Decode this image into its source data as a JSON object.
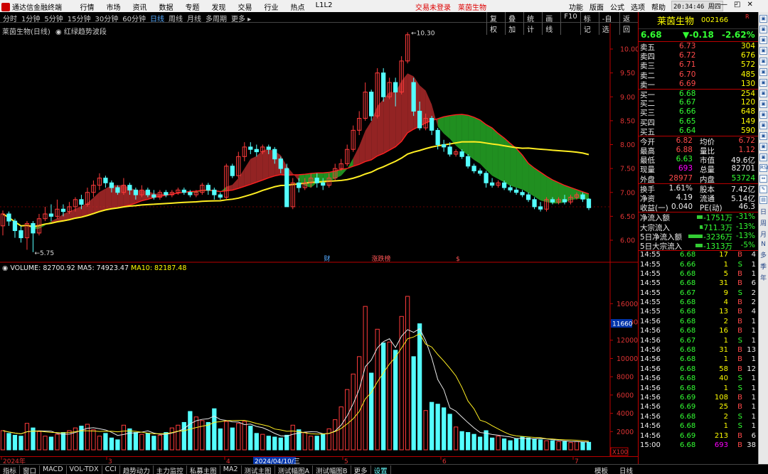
{
  "app": {
    "title": "通达信金融终端",
    "menu": [
      "行情",
      "市场",
      "资讯",
      "数据",
      "专题",
      "发现",
      "交易",
      "行业",
      "热点",
      "L1L2"
    ],
    "login_status": "交易未登录",
    "stock_tab": "莱茵生物",
    "right_menu": [
      "功能",
      "版面",
      "公式",
      "选项",
      "帮助"
    ],
    "clock": "20:34:46 周四",
    "window_buttons": [
      "—",
      "◰",
      "✕"
    ]
  },
  "toolbar": {
    "periods": [
      "分时",
      "1分钟",
      "5分钟",
      "15分钟",
      "30分钟",
      "60分钟",
      "日线",
      "周线",
      "月线",
      "多周期",
      "更多 ▸"
    ],
    "active_period": "日线",
    "tools": [
      "复权",
      "叠加",
      "统计",
      "画线",
      "F10",
      "标记",
      "-自选",
      "返回"
    ]
  },
  "kline": {
    "title": "莱茵生物(日线)",
    "indicator": "红绿趋势波段",
    "high_label": "10.30",
    "low_label": "5.75",
    "y_ticks": [
      "10.00",
      "9.50",
      "9.00",
      "8.50",
      "8.00",
      "7.50",
      "7.00",
      "6.50",
      "6.00"
    ],
    "event_markers": [
      "财",
      "涨跌榜",
      "$"
    ]
  },
  "volume": {
    "legend_vol": "VOLUME: 82700.92",
    "legend_ma5": "MA5: 74923.47",
    "legend_ma10": "MA10: 82187.48",
    "y_ticks": [
      "16000",
      "14000",
      "12000",
      "10000",
      "8000",
      "6000",
      "4000",
      "2000"
    ],
    "current_tag": "11660",
    "unit_tag": "X100"
  },
  "date_axis": {
    "labels": [
      "2024年",
      "3",
      "4",
      "5",
      "6",
      "7"
    ],
    "cursor_date": "2024/04/10/三"
  },
  "bottom_tabs": [
    "指标",
    "窗口",
    "MACD",
    "VOL-TDX",
    "CCI",
    "趋势动力",
    "主力监控",
    "私募主图",
    "MA2",
    "测试主图",
    "测试幅图A",
    "测试幅图B",
    "更多",
    "设置"
  ],
  "bottom_right": [
    "模板",
    "日线"
  ],
  "quote": {
    "name": "莱茵生物",
    "code": "002166",
    "flag": "R",
    "price": "6.68",
    "change": "▼-0.18",
    "change_pct": "-2.62%",
    "order_book": [
      {
        "label": "卖五",
        "price": "6.73",
        "vol": "304",
        "pc": "red"
      },
      {
        "label": "卖四",
        "price": "6.72",
        "vol": "676",
        "pc": "red"
      },
      {
        "label": "卖三",
        "price": "6.71",
        "vol": "572",
        "pc": "red"
      },
      {
        "label": "卖二",
        "price": "6.70",
        "vol": "485",
        "pc": "red"
      },
      {
        "label": "卖一",
        "price": "6.69",
        "vol": "130",
        "pc": "red"
      },
      {
        "label": "买一",
        "price": "6.68",
        "vol": "254",
        "pc": "green"
      },
      {
        "label": "买二",
        "price": "6.67",
        "vol": "120",
        "pc": "green"
      },
      {
        "label": "买三",
        "price": "6.66",
        "vol": "648",
        "pc": "green"
      },
      {
        "label": "买四",
        "price": "6.65",
        "vol": "149",
        "pc": "green"
      },
      {
        "label": "买五",
        "price": "6.64",
        "vol": "590",
        "pc": "green"
      }
    ],
    "stats": [
      {
        "l1": "今开",
        "v1": "6.82",
        "c1": "red",
        "l2": "均价",
        "v2": "6.72",
        "c2": "red"
      },
      {
        "l1": "最高",
        "v1": "6.88",
        "c1": "red",
        "l2": "量比",
        "v2": "1.12",
        "c2": "red"
      },
      {
        "l1": "最低",
        "v1": "6.63",
        "c1": "green",
        "l2": "市值",
        "v2": "49.6亿",
        "c2": "white"
      },
      {
        "l1": "现量",
        "v1": "693",
        "c1": "magenta",
        "l2": "总量",
        "v2": "82701",
        "c2": "white"
      },
      {
        "l1": "外盘",
        "v1": "28977",
        "c1": "red",
        "l2": "内盘",
        "v2": "53724",
        "c2": "green"
      }
    ],
    "stats2": [
      {
        "l1": "换手",
        "v1": "1.61%",
        "c1": "white",
        "l2": "股本",
        "v2": "7.42亿",
        "c2": "white"
      },
      {
        "l1": "净资",
        "v1": "4.19",
        "c1": "white",
        "l2": "流通",
        "v2": "5.14亿",
        "c2": "white"
      },
      {
        "l1": "收益(一)",
        "v1": "0.040",
        "c1": "white",
        "l2": "PE(动)",
        "v2": "46.3",
        "c2": "white"
      }
    ],
    "flows": [
      {
        "label": "净流入额",
        "amount": "-1751万",
        "pct": "-31%"
      },
      {
        "label": "大宗流入",
        "amount": "-711.3万",
        "pct": "-13%"
      },
      {
        "label": "5日净流入额",
        "amount": "-3236万",
        "pct": "-13%"
      },
      {
        "label": "5日大宗流入",
        "amount": "-1313万",
        "pct": "-5%"
      }
    ],
    "ticks": [
      {
        "t": "14:55",
        "p": "6.68",
        "v": "17",
        "bs": "B",
        "n": "4"
      },
      {
        "t": "14:55",
        "p": "6.66",
        "v": "1",
        "bs": "S",
        "n": "1"
      },
      {
        "t": "14:55",
        "p": "6.68",
        "v": "5",
        "bs": "B",
        "n": "1"
      },
      {
        "t": "14:55",
        "p": "6.68",
        "v": "31",
        "bs": "B",
        "n": "6"
      },
      {
        "t": "14:55",
        "p": "6.67",
        "v": "9",
        "bs": "S",
        "n": "2"
      },
      {
        "t": "14:55",
        "p": "6.68",
        "v": "4",
        "bs": "B",
        "n": "2"
      },
      {
        "t": "14:55",
        "p": "6.68",
        "v": "13",
        "bs": "B",
        "n": "4"
      },
      {
        "t": "14:56",
        "p": "6.68",
        "v": "2",
        "bs": "B",
        "n": "1"
      },
      {
        "t": "14:56",
        "p": "6.68",
        "v": "16",
        "bs": "B",
        "n": "1"
      },
      {
        "t": "14:56",
        "p": "6.67",
        "v": "1",
        "bs": "S",
        "n": "1"
      },
      {
        "t": "14:56",
        "p": "6.68",
        "v": "31",
        "bs": "B",
        "n": "13"
      },
      {
        "t": "14:56",
        "p": "6.68",
        "v": "1",
        "bs": "B",
        "n": "1"
      },
      {
        "t": "14:56",
        "p": "6.68",
        "v": "58",
        "bs": "B",
        "n": "12"
      },
      {
        "t": "14:56",
        "p": "6.68",
        "v": "40",
        "bs": "S",
        "n": "1"
      },
      {
        "t": "14:56",
        "p": "6.68",
        "v": "1",
        "bs": "S",
        "n": "1"
      },
      {
        "t": "14:56",
        "p": "6.69",
        "v": "108",
        "bs": "B",
        "n": "1"
      },
      {
        "t": "14:56",
        "p": "6.69",
        "v": "25",
        "bs": "B",
        "n": "1"
      },
      {
        "t": "14:56",
        "p": "6.68",
        "v": "2",
        "bs": "S",
        "n": "1"
      },
      {
        "t": "14:56",
        "p": "6.68",
        "v": "1",
        "bs": "S",
        "n": "1"
      },
      {
        "t": "14:56",
        "p": "6.69",
        "v": "213",
        "bs": "B",
        "n": "6"
      },
      {
        "t": "15:00",
        "p": "6.68",
        "v": "693",
        "bs": "B",
        "n": "38"
      }
    ]
  },
  "sidebar": {
    "icons": [
      "RSI",
      "⇔",
      "✎",
      "▤"
    ],
    "text_vertical": [
      "日",
      "周",
      "月",
      "N",
      "多",
      "季",
      "年"
    ]
  },
  "chart_data": {
    "type": "candlestick",
    "start_date": "2024-01",
    "candles": [
      [
        6.3,
        6.55,
        6.1,
        6.62
      ],
      [
        6.55,
        6.4,
        6.3,
        6.6
      ],
      [
        6.4,
        6.2,
        6.05,
        6.45
      ],
      [
        6.2,
        6.05,
        5.95,
        6.3
      ],
      [
        6.05,
        6.35,
        5.8,
        6.4
      ],
      [
        6.35,
        6.15,
        5.75,
        6.4
      ],
      [
        6.15,
        6.45,
        6.1,
        6.55
      ],
      [
        6.45,
        6.55,
        6.4,
        6.7
      ],
      [
        6.55,
        6.5,
        6.4,
        6.75
      ],
      [
        6.5,
        6.65,
        6.45,
        6.85
      ],
      [
        6.65,
        6.6,
        6.5,
        6.75
      ],
      [
        6.6,
        6.7,
        6.55,
        6.8
      ],
      [
        6.7,
        6.85,
        6.6,
        6.9
      ],
      [
        6.85,
        6.75,
        6.65,
        6.95
      ],
      [
        6.75,
        7.0,
        6.7,
        7.1
      ],
      [
        7.0,
        7.15,
        6.9,
        7.25
      ],
      [
        7.15,
        7.3,
        7.05,
        7.4
      ],
      [
        7.3,
        7.2,
        7.1,
        7.35
      ],
      [
        7.2,
        7.1,
        7.0,
        7.25
      ],
      [
        7.1,
        7.0,
        6.95,
        7.15
      ],
      [
        7.0,
        7.15,
        6.95,
        7.3
      ],
      [
        7.15,
        7.05,
        6.95,
        7.2
      ],
      [
        7.05,
        6.95,
        6.85,
        7.1
      ],
      [
        6.95,
        7.05,
        6.9,
        7.15
      ],
      [
        7.05,
        6.95,
        6.9,
        7.1
      ],
      [
        6.95,
        6.9,
        6.85,
        7.05
      ],
      [
        6.9,
        7.0,
        6.85,
        7.05
      ],
      [
        7.0,
        6.95,
        6.9,
        7.05
      ],
      [
        6.95,
        7.0,
        6.9,
        7.05
      ],
      [
        7.0,
        7.05,
        6.95,
        7.1
      ],
      [
        7.05,
        7.0,
        6.95,
        7.1
      ],
      [
        7.0,
        6.95,
        6.9,
        7.05
      ],
      [
        6.95,
        7.0,
        6.9,
        7.05
      ],
      [
        7.0,
        7.15,
        6.95,
        7.2
      ],
      [
        7.15,
        7.05,
        6.95,
        7.2
      ],
      [
        7.05,
        6.95,
        6.85,
        7.1
      ],
      [
        6.95,
        6.9,
        6.85,
        7.0
      ],
      [
        6.9,
        7.55,
        6.85,
        7.6
      ],
      [
        7.55,
        7.35,
        7.3,
        7.6
      ],
      [
        7.35,
        7.75,
        7.3,
        7.85
      ],
      [
        7.75,
        7.95,
        7.65,
        8.05
      ],
      [
        7.95,
        7.9,
        7.8,
        8.05
      ],
      [
        7.9,
        7.85,
        7.75,
        8.0
      ],
      [
        7.85,
        7.95,
        7.8,
        8.0
      ],
      [
        7.95,
        7.9,
        7.8,
        8.0
      ],
      [
        7.9,
        7.7,
        7.6,
        7.95
      ],
      [
        7.7,
        7.5,
        7.4,
        7.75
      ],
      [
        7.5,
        6.7,
        6.7,
        7.6
      ],
      [
        6.7,
        7.2,
        6.65,
        7.3
      ],
      [
        7.2,
        7.1,
        7.0,
        7.3
      ],
      [
        7.1,
        7.2,
        7.05,
        7.3
      ],
      [
        7.2,
        7.3,
        7.1,
        7.4
      ],
      [
        7.3,
        7.2,
        7.1,
        7.4
      ],
      [
        7.2,
        7.15,
        7.05,
        7.3
      ],
      [
        7.15,
        7.3,
        7.1,
        7.4
      ],
      [
        7.3,
        7.5,
        7.25,
        7.6
      ],
      [
        7.5,
        7.6,
        7.45,
        7.7
      ],
      [
        7.6,
        7.9,
        7.55,
        8.0
      ],
      [
        7.9,
        8.3,
        7.85,
        8.4
      ],
      [
        8.3,
        8.55,
        8.2,
        8.7
      ],
      [
        8.55,
        9.1,
        8.5,
        9.3
      ],
      [
        9.1,
        8.6,
        8.5,
        9.15
      ],
      [
        8.6,
        9.5,
        8.55,
        9.6
      ],
      [
        9.5,
        9.0,
        8.9,
        9.6
      ],
      [
        9.0,
        9.3,
        8.95,
        9.4
      ],
      [
        9.3,
        9.1,
        8.8,
        9.4
      ],
      [
        9.1,
        9.75,
        9.05,
        9.85
      ],
      [
        9.75,
        10.3,
        9.7,
        10.35
      ],
      [
        9.3,
        8.7,
        8.6,
        9.4
      ],
      [
        8.7,
        8.35,
        8.3,
        8.9
      ],
      [
        8.35,
        8.55,
        8.3,
        8.65
      ],
      [
        8.55,
        8.3,
        8.2,
        8.6
      ],
      [
        8.3,
        8.0,
        7.9,
        8.35
      ],
      [
        8.0,
        7.95,
        7.85,
        8.1
      ],
      [
        7.95,
        7.8,
        7.75,
        8.05
      ],
      [
        7.8,
        7.85,
        7.75,
        7.9
      ],
      [
        7.85,
        7.75,
        7.7,
        7.9
      ],
      [
        7.75,
        7.55,
        7.5,
        7.8
      ],
      [
        7.55,
        7.45,
        7.4,
        7.6
      ],
      [
        7.45,
        7.4,
        7.35,
        7.5
      ],
      [
        7.4,
        7.2,
        7.1,
        7.45
      ],
      [
        7.2,
        7.15,
        7.1,
        7.3
      ],
      [
        7.15,
        7.2,
        7.1,
        7.25
      ],
      [
        7.2,
        7.1,
        7.05,
        7.25
      ],
      [
        7.1,
        7.05,
        7.0,
        7.15
      ],
      [
        7.05,
        7.0,
        6.95,
        7.1
      ],
      [
        7.0,
        6.95,
        6.9,
        7.05
      ],
      [
        6.95,
        6.85,
        6.8,
        7.0
      ],
      [
        6.85,
        6.7,
        6.65,
        6.9
      ],
      [
        6.7,
        6.65,
        6.6,
        6.8
      ],
      [
        6.65,
        6.85,
        6.6,
        6.9
      ],
      [
        6.85,
        6.8,
        6.75,
        6.9
      ],
      [
        6.8,
        6.85,
        6.75,
        6.9
      ],
      [
        6.85,
        6.8,
        6.75,
        6.95
      ],
      [
        6.8,
        6.9,
        6.75,
        6.95
      ],
      [
        6.9,
        6.95,
        6.85,
        7.0
      ],
      [
        6.95,
        6.86,
        6.8,
        7.0
      ],
      [
        6.86,
        6.68,
        6.63,
        6.88
      ]
    ],
    "volumes": [
      2100,
      1800,
      1600,
      1500,
      2900,
      2400,
      2000,
      1500,
      1400,
      1700,
      1900,
      2100,
      2400,
      2600,
      2800,
      2200,
      1500,
      1800,
      1300,
      1100,
      2700,
      2300,
      1900,
      1700,
      1800,
      1500,
      1600,
      1900,
      2400,
      2700,
      3000,
      4200,
      3600,
      3200,
      3000,
      4500,
      2300,
      3100,
      2400,
      2900,
      3100,
      2600,
      1800,
      1700,
      1500,
      1400,
      1300,
      1600,
      2700,
      2200,
      1900,
      1500,
      1500,
      1700,
      2300,
      3300,
      4700,
      6600,
      8300,
      10200,
      15700,
      8400,
      13200,
      11700,
      11800,
      10900,
      14600,
      16800,
      10200,
      13800,
      4300,
      5200,
      5000,
      4600,
      3900,
      2500,
      2000,
      1900,
      1700,
      1400,
      2100,
      1300,
      1500,
      1200,
      1000,
      1200,
      1400,
      1300,
      1200,
      1100,
      1000,
      1000,
      900,
      900,
      800,
      900,
      850,
      830
    ],
    "ma_volume": {
      "MA5": 74923.47,
      "MA10": 82187.48,
      "VOLUME": 82700.92
    },
    "ylim_price": [
      5.5,
      10.5
    ],
    "ylim_volume": [
      0,
      17000
    ]
  },
  "colors": {
    "up": "#ff3b3b",
    "down": "#54ffff",
    "ma_long": "#ffee22",
    "ma_mid": "#ff2020",
    "band_green": "#2dcc2d",
    "band_red": "#d23232",
    "band_magenta": "#c82cc8"
  }
}
